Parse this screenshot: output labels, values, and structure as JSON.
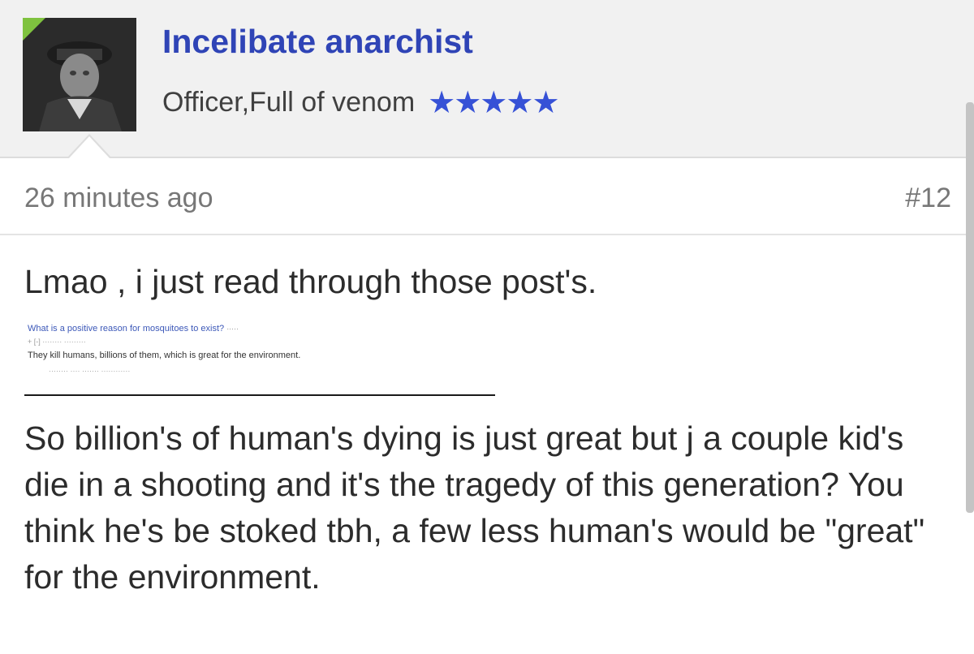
{
  "user": {
    "name": "Incelibate anarchist",
    "rank": "Officer,Full of venom",
    "stars": "★★★★★",
    "accent_color": "#2f44b6",
    "star_color": "#3651d6",
    "badge_color": "#7fc23f"
  },
  "post": {
    "timestamp": "26 minutes ago",
    "number": "#12",
    "line1": "Lmao , i just read through those post's.",
    "paragraph": "So billion's of human's dying is just great but j a couple kid's die in a shooting and it's the tragedy of this generation? You think he's be stoked tbh, a few less human's would be \"great\" for the environment."
  },
  "embed": {
    "question": "What is a positive reason for mosquitoes to exist?",
    "comment": "They kill humans, billions of them, which is great for the environment."
  },
  "icons": [
    "avatar-image",
    "star-icon",
    "speech-caret"
  ]
}
